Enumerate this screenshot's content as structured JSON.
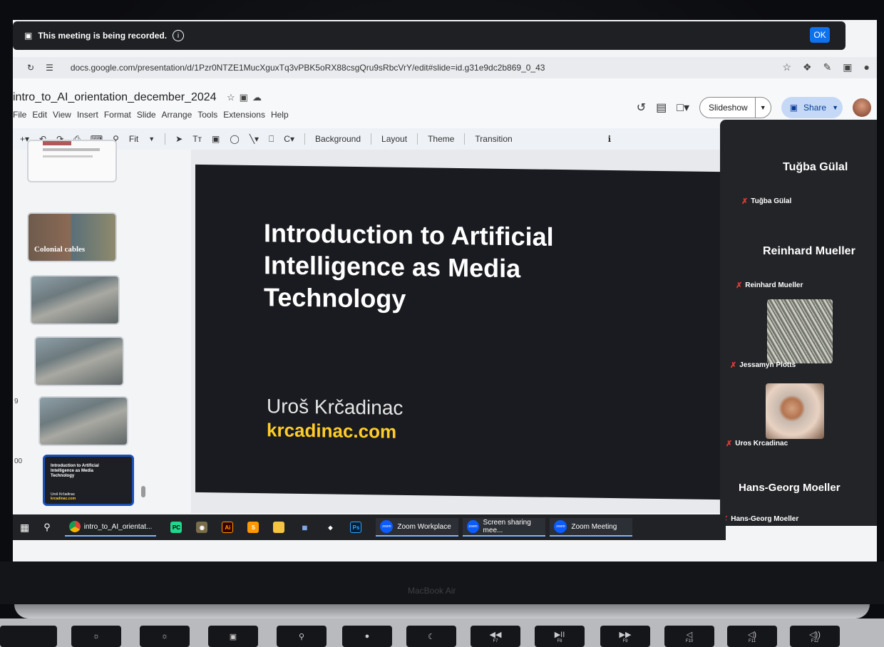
{
  "recording_banner": {
    "text": "This meeting is being recorded.",
    "ok_label": "OK",
    "info_glyph": "i"
  },
  "browser": {
    "url": "docs.google.com/presentation/d/1Pzr0NTZE1MucXguxTq3vPBK5oRX88csgQru9sRbcVrY/edit#slide=id.g31e9dc2b869_0_43"
  },
  "docs": {
    "title": "intro_to_AI_orientation_december_2024",
    "menus": [
      "File",
      "Edit",
      "View",
      "Insert",
      "Format",
      "Slide",
      "Arrange",
      "Tools",
      "Extensions",
      "Help"
    ],
    "slideshow_label": "Slideshow",
    "share_label": "Share"
  },
  "toolbar": {
    "zoom_label": "Fit",
    "background": "Background",
    "layout": "Layout",
    "theme": "Theme",
    "transition": "Transition"
  },
  "filmstrip": {
    "colonial_caption": "Colonial cables",
    "numbers": {
      "n9": "9",
      "n10": "00"
    },
    "current_thumb": {
      "title": "Introduction to Artificial Intelligence as Media Technology",
      "author": "Uroš Krčadinac",
      "link": "krcadinac.com"
    }
  },
  "slide": {
    "title": "Introduction to Artificial Intelligence as Media Technology",
    "author": "Uroš Krčadinac",
    "link": "krcadinac.com",
    "colors": {
      "background": "#1a1b20",
      "title": "#ffffff",
      "link": "#ffcc29"
    }
  },
  "zoom_panel": {
    "participants": [
      {
        "big_name": "Tuğba Gülal",
        "label": "Tuğba Gülal"
      },
      {
        "big_name": "Reinhard Mueller",
        "label": "Reinhard Mueller"
      },
      {
        "label": "Jessamyn Plotts"
      },
      {
        "label": "Uros Krcadinac"
      },
      {
        "big_name": "Hans-Georg Moeller",
        "label": "Hans-Georg Moeller"
      }
    ]
  },
  "taskbar": {
    "chrome_label": "intro_to_AI_orientat...",
    "pycharm_label": "PC",
    "illustrator_label": "Ai",
    "photoshop_label": "Ps",
    "zoom_workplace": "Zoom Workplace",
    "screen_sharing": "Screen sharing mee...",
    "zoom_meeting": "Zoom Meeting",
    "zoom_icon_text": "zoom"
  },
  "device": {
    "label": "MacBook Air"
  },
  "keys": [
    "F7",
    "F8",
    "F9",
    "F10",
    "F11",
    "F12"
  ]
}
